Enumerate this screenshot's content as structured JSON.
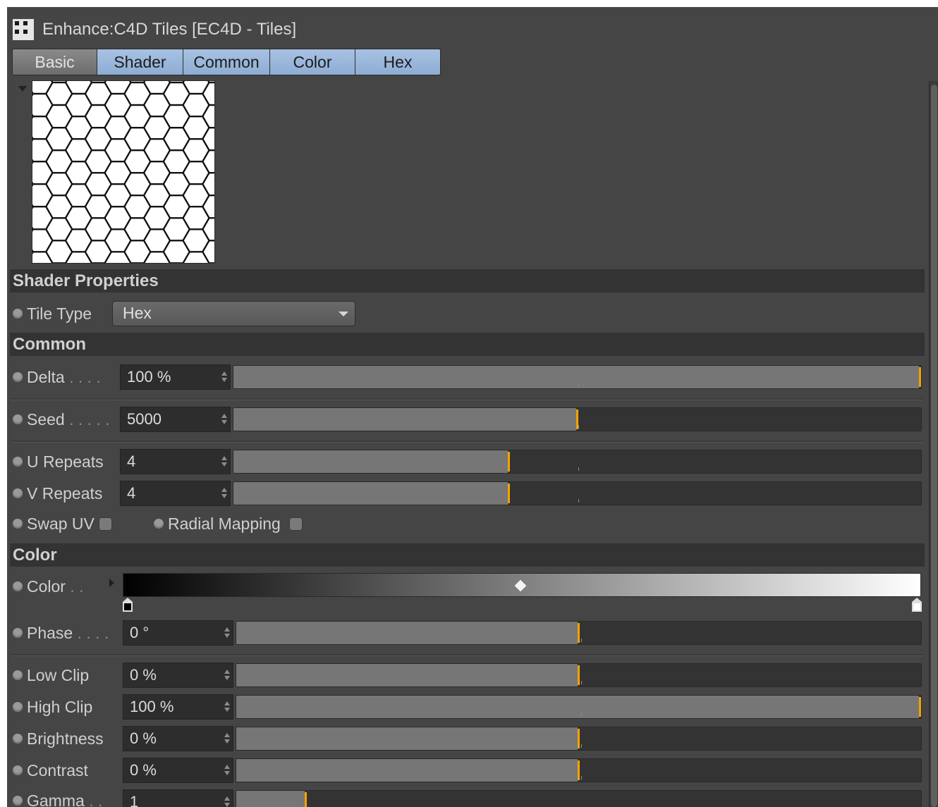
{
  "window": {
    "title": "Enhance:C4D Tiles [EC4D - Tiles]"
  },
  "tabs": [
    {
      "label": "Basic",
      "state": "inactive"
    },
    {
      "label": "Shader",
      "state": "active"
    },
    {
      "label": "Common",
      "state": "active"
    },
    {
      "label": "Color",
      "state": "active"
    },
    {
      "label": "Hex",
      "state": "active"
    }
  ],
  "preview": {
    "pattern": "hexagonal-tiles",
    "icon": "hex-tile-preview"
  },
  "sections": {
    "shader_properties": "Shader Properties",
    "common": "Common",
    "color": "Color"
  },
  "shader_properties": {
    "tile_type": {
      "label": "Tile Type",
      "value": "Hex"
    }
  },
  "common": {
    "delta": {
      "label": "Delta",
      "dots": " . . . .",
      "value": "100 %",
      "level": 1.0
    },
    "seed": {
      "label": "Seed",
      "dots": " . . . . .",
      "value": "5000",
      "level": 0.5
    },
    "u_repeats": {
      "label": "U Repeats",
      "value": "4",
      "level": 0.4
    },
    "v_repeats": {
      "label": "V Repeats",
      "value": "4",
      "level": 0.4
    },
    "swap_uv": {
      "label": "Swap UV",
      "checked": false
    },
    "radial_mapping": {
      "label": "Radial Mapping",
      "checked": false
    }
  },
  "color": {
    "gradient": {
      "label": "Color",
      "dots": " . .",
      "start": "#000000",
      "end": "#ffffff"
    },
    "phase": {
      "label": "Phase",
      "dots": " . . . .",
      "value": "0 °",
      "level": 0.5
    },
    "low_clip": {
      "label": "Low Clip",
      "value": "0 %",
      "level": 0.5
    },
    "high_clip": {
      "label": "High Clip",
      "value": "100 %",
      "level": 1.0
    },
    "brightness": {
      "label": "Brightness",
      "value": "0 %",
      "level": 0.5
    },
    "contrast": {
      "label": "Contrast",
      "value": "0 %",
      "level": 0.5
    },
    "gamma": {
      "label": "Gamma",
      "dots": " . .",
      "value": "1",
      "level": 0.1
    }
  },
  "colors": {
    "accent": "#f5a300",
    "panel": "#454545",
    "tab_active": "#99b6da"
  }
}
